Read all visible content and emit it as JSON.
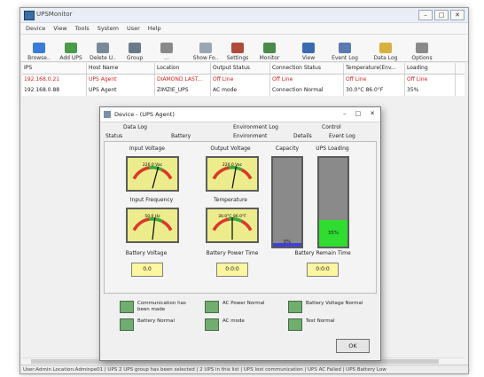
{
  "window": {
    "title": "UPSMonitor"
  },
  "menu": [
    "Device",
    "View",
    "Tools",
    "System",
    "User",
    "Help"
  ],
  "toolbar": [
    {
      "label": "Browse..",
      "icon": "browse-icon",
      "color": "#3a7bd5"
    },
    {
      "label": "Add UPS",
      "icon": "add-ups-icon",
      "color": "#4a9a4a"
    },
    {
      "label": "Delete U..",
      "icon": "delete-ups-icon",
      "color": "#7a8a9a"
    },
    {
      "label": "Group",
      "icon": "group-icon",
      "color": "#6a7a8a"
    },
    {
      "label": "...",
      "icon": "tool-icon",
      "color": "#8a8a8a"
    },
    {
      "label": "Show Fo..",
      "icon": "show-icon",
      "color": "#9aa6b4"
    },
    {
      "label": "Settings",
      "icon": "settings-icon",
      "color": "#b04a3a"
    },
    {
      "label": "Monitor",
      "icon": "monitor-icon",
      "color": "#4a8a4a"
    },
    {
      "label": "View",
      "icon": "view-icon",
      "color": "#3a6ab0"
    },
    {
      "label": "Event Log",
      "icon": "event-log-icon",
      "color": "#5a7ab0"
    },
    {
      "label": "Data Log",
      "icon": "data-log-icon",
      "color": "#d8b040"
    },
    {
      "label": "Options",
      "icon": "options-icon",
      "color": "#8a8a8a"
    }
  ],
  "grid": {
    "columns": [
      "IPS",
      "Host Name",
      "Location",
      "Output Status",
      "Connection Status",
      "Temperature(Env...",
      "Loading"
    ],
    "rows": [
      [
        "192.168.0.21",
        "UPS Agent",
        "DIAMOND LAST...",
        "Off Line",
        "Off Line",
        "Off Line",
        "Off Line"
      ],
      [
        "192.168.0.88",
        "UPS Agent",
        "ZIMZIE_UPS",
        "AC mode",
        "Connection Normal",
        "30.0°C 86.0°F",
        "35%"
      ]
    ]
  },
  "statusbar": "User:Admin Location:Adminpe01 | UPS 2 UPS group has been selected | 2 UPS in this list | UPS lost communication | UPS AC Failed | UPS Battery Low",
  "dialog": {
    "title": "Device - (UPS Agent)",
    "tabs_top": [
      "Data Log",
      "Environment Log",
      "Control"
    ],
    "tabs_bottom": [
      "Status",
      "Battery",
      "Environment",
      "Details",
      "Event Log"
    ],
    "gauges": [
      {
        "label": "Input Voltage",
        "scale": "220.0 Vac",
        "level": 0.62
      },
      {
        "label": "Output Voltage",
        "scale": "220.0 Vac",
        "level": 0.58
      },
      {
        "label": "Input Frequency",
        "scale": "50.0 Hz",
        "level": 0.55
      },
      {
        "label": "Temperature",
        "scale": "30.0°C  86.0°F",
        "level": 0.5
      }
    ],
    "capacity": {
      "label": "Capacity",
      "value": "0%",
      "level": 0.04
    },
    "loading": {
      "label": "UPS Loading",
      "value": "35%",
      "level": 0.3
    },
    "battery_voltage": {
      "label": "Battery Voltage",
      "value": "0.0"
    },
    "battery_time": {
      "label": "Battery Power Time",
      "value": "0:0:0"
    },
    "battery_remain": {
      "label": "Battery Remain Time",
      "value": "0:0:0"
    },
    "legend": [
      {
        "text": "Communication has been made",
        "icon": "communication-icon"
      },
      {
        "text": "AC Power Normal",
        "icon": "ac-power-icon"
      },
      {
        "text": "Battery Voltage Normal",
        "icon": "battery-voltage-icon"
      },
      {
        "text": "Battery Normal",
        "icon": "battery-icon"
      },
      {
        "text": "AC mode",
        "icon": "ac-mode-icon"
      },
      {
        "text": "Test Normal",
        "icon": "test-icon"
      }
    ],
    "ok_label": "OK"
  }
}
